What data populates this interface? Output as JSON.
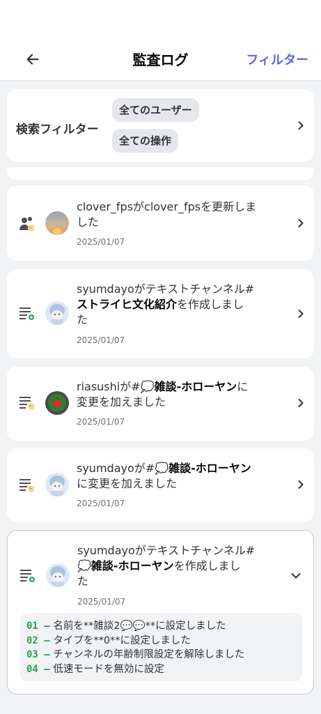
{
  "header": {
    "title": "監査ログ",
    "filter_label": "フィルター"
  },
  "search_filter": {
    "label": "検索フィルター",
    "user_chip": "全てのユーザー",
    "action_chip": "全ての操作"
  },
  "entries": [
    {
      "action_icon": "member-update-icon",
      "avatar": "avatar-clover-fps",
      "user": "clover_fps",
      "line1": "clover_fpsがclover_fpsを更新しま",
      "line2": "した",
      "date": "2025/01/07"
    },
    {
      "action_icon": "channel-create-icon",
      "avatar": "avatar-syumdayo",
      "line1": "syumdayoがテキストチャンネル#",
      "line2_bold": "ストライヒ文化紹介",
      "line2_rest": "を作成しまし",
      "line3": "た",
      "date": "2025/01/07"
    },
    {
      "action_icon": "channel-update-icon",
      "avatar": "avatar-riasushi",
      "line1_pre": "riasushiが#",
      "line1_bold": "💭雑談-ホローヤン",
      "line1_post": "に",
      "line2": "変更を加えました",
      "date": "2025/01/07"
    },
    {
      "action_icon": "channel-update-icon",
      "avatar": "avatar-syumdayo",
      "line1_pre": "syumdayoが#",
      "line1_bold": "💭雑談-ホローヤン",
      "line2": "に変更を加えました",
      "date": "2025/01/07"
    },
    {
      "action_icon": "channel-create-icon",
      "avatar": "avatar-syumdayo",
      "line1": "syumdayoがテキストチャンネル#",
      "line2_bold": "💭雑談-ホローヤン",
      "line2_rest": "を作成しまし",
      "line3": "た",
      "date": "2025/01/07",
      "changes": [
        {
          "num": "01 —",
          "text": "名前を**雑談2💬💬**に設定しました"
        },
        {
          "num": "02 —",
          "text": "タイプを**0**に設定しました"
        },
        {
          "num": "03 —",
          "text": "チャンネルの年齢制限設定を解除しました"
        },
        {
          "num": "04 —",
          "text": "低速モードを無効に設定"
        }
      ]
    }
  ],
  "colors": {
    "accent": "#5865f2",
    "change_number": "#23a55a",
    "badge_update": "#f0b232",
    "badge_create": "#23a55a"
  }
}
